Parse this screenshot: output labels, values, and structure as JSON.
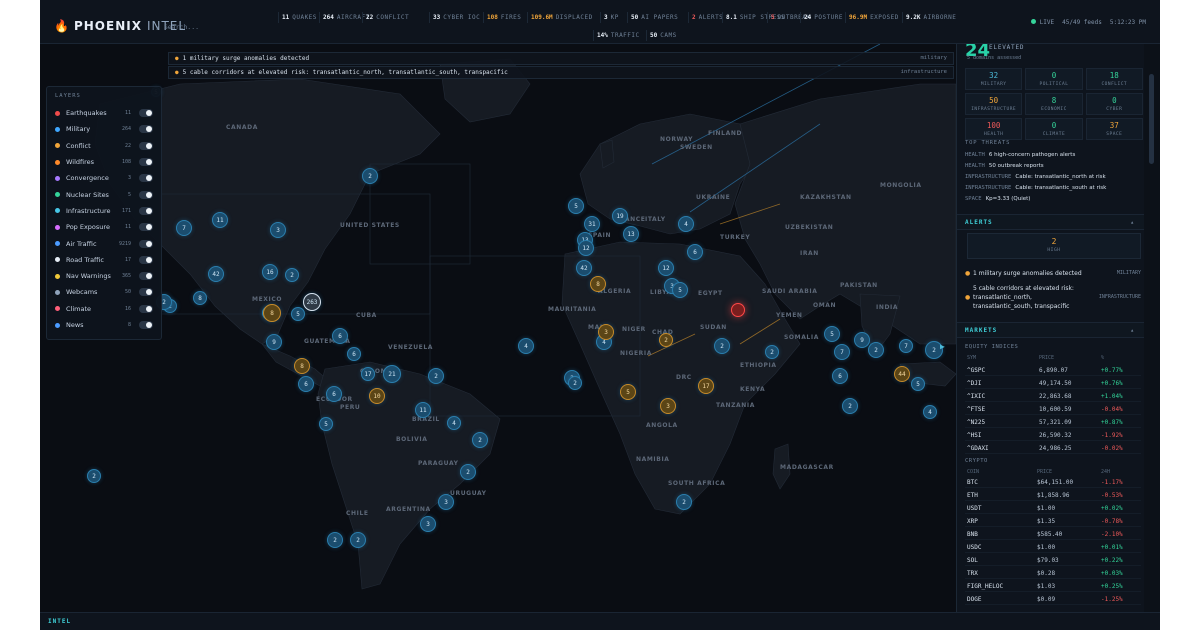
{
  "app": {
    "brand": "PHOENIX",
    "brand_suffix": "INTEL",
    "flame_icon": "flame-icon"
  },
  "search": {
    "placeholder": "/ Search..."
  },
  "stats": [
    {
      "num": "11",
      "label": "QUAKES",
      "tone": "normal"
    },
    {
      "num": "264",
      "label": "AIRCRAFT",
      "tone": "normal"
    },
    {
      "num": "22",
      "label": "CONFLICT",
      "tone": "normal"
    },
    {
      "num": "33",
      "label": "CYBER IOC",
      "tone": "normal"
    },
    {
      "num": "108",
      "label": "FIRES",
      "tone": "orange"
    },
    {
      "num": "109.6M",
      "label": "DISPLACED",
      "tone": "orange"
    },
    {
      "num": "3",
      "label": "KP",
      "tone": "normal"
    },
    {
      "num": "50",
      "label": "AI PAPERS",
      "tone": "normal"
    },
    {
      "num": "2",
      "label": "ALERTS",
      "tone": "red"
    },
    {
      "num": "8.1",
      "label": "SHIP STRESS",
      "tone": "normal"
    },
    {
      "num": "5",
      "label": "OUTBREAK",
      "tone": "red"
    },
    {
      "num": "24",
      "label": "POSTURE",
      "tone": "normal"
    },
    {
      "num": "96.9M",
      "label": "EXPOSED",
      "tone": "orange"
    },
    {
      "num": "9.2K",
      "label": "AIRBORNE",
      "tone": "normal"
    },
    {
      "num": "14%",
      "label": "TRAFFIC",
      "tone": "normal"
    },
    {
      "num": "50",
      "label": "CAMS",
      "tone": "normal"
    }
  ],
  "status": {
    "live": "LIVE",
    "feeds": "45/49 feeds",
    "time": "5:12:23 PM"
  },
  "ticker": [
    {
      "text": "1 military surge anomalies detected",
      "category": "military"
    },
    {
      "text": "5 cable corridors at elevated risk: transatlantic_north, transatlantic_south, transpacific",
      "category": "infrastructure"
    }
  ],
  "layers": {
    "header": "LAYERS",
    "items": [
      {
        "label": "Earthquakes",
        "count": "11",
        "color": "#ef4b4b"
      },
      {
        "label": "Military",
        "count": "264",
        "color": "#3fa7ff"
      },
      {
        "label": "Conflict",
        "count": "22",
        "color": "#f0a53a"
      },
      {
        "label": "Wildfires",
        "count": "108",
        "color": "#ff8a2a"
      },
      {
        "label": "Convergence",
        "count": "3",
        "color": "#a779ff"
      },
      {
        "label": "Nuclear Sites",
        "count": "5",
        "color": "#35d49a"
      },
      {
        "label": "Infrastructure",
        "count": "171",
        "color": "#47c6e6"
      },
      {
        "label": "Pop Exposure",
        "count": "11",
        "color": "#d66dff"
      },
      {
        "label": "Air Traffic",
        "count": "9219",
        "color": "#4b9bff"
      },
      {
        "label": "Road Traffic",
        "count": "17",
        "color": "#e6edf6"
      },
      {
        "label": "Nav Warnings",
        "count": "365",
        "color": "#f0c93a"
      },
      {
        "label": "Webcams",
        "count": "50",
        "color": "#8fa3bb"
      },
      {
        "label": "Climate",
        "count": "16",
        "color": "#ff5f7a"
      },
      {
        "label": "News",
        "count": "8",
        "color": "#4b9bff"
      }
    ]
  },
  "countries": [
    {
      "name": "CANADA"
    },
    {
      "name": "UNITED STATES"
    },
    {
      "name": "MEXICO"
    },
    {
      "name": "CUBA"
    },
    {
      "name": "GUATEMALA"
    },
    {
      "name": "VENEZUELA"
    },
    {
      "name": "COLOMBIA"
    },
    {
      "name": "ECUADOR"
    },
    {
      "name": "PERU"
    },
    {
      "name": "BRAZIL"
    },
    {
      "name": "BOLIVIA"
    },
    {
      "name": "PARAGUAY"
    },
    {
      "name": "CHILE"
    },
    {
      "name": "ARGENTINA"
    },
    {
      "name": "URUGUAY"
    },
    {
      "name": "ALGERIA"
    },
    {
      "name": "LIBYA"
    },
    {
      "name": "EGYPT"
    },
    {
      "name": "MALI"
    },
    {
      "name": "NIGER"
    },
    {
      "name": "CHAD"
    },
    {
      "name": "SUDAN"
    },
    {
      "name": "NIGERIA"
    },
    {
      "name": "ETHIOPIA"
    },
    {
      "name": "KENYA"
    },
    {
      "name": "ANGOLA"
    },
    {
      "name": "TANZANIA"
    },
    {
      "name": "NAMIBIA"
    },
    {
      "name": "SOUTH AFRICA"
    },
    {
      "name": "MADAGASCAR"
    },
    {
      "name": "MAURITANIA"
    },
    {
      "name": "TURKEY"
    },
    {
      "name": "IRAN"
    },
    {
      "name": "PAKISTAN"
    },
    {
      "name": "SAUDI ARABIA"
    },
    {
      "name": "KAZAKHSTAN"
    },
    {
      "name": "UZBEKISTAN"
    },
    {
      "name": "INDIA"
    },
    {
      "name": "MONGOLIA"
    },
    {
      "name": "UKRAINE"
    },
    {
      "name": "FRANCE"
    },
    {
      "name": "SPAIN"
    },
    {
      "name": "ITALY"
    },
    {
      "name": "YEMEN"
    },
    {
      "name": "OMAN"
    },
    {
      "name": "NORWAY"
    },
    {
      "name": "SWEDEN"
    },
    {
      "name": "FINLAND"
    },
    {
      "name": "SOMALIA"
    },
    {
      "name": "DRC"
    }
  ],
  "clusters": [
    {
      "v": "5",
      "t": "blue"
    },
    {
      "v": "2",
      "t": "blue"
    },
    {
      "v": "7",
      "t": "blue"
    },
    {
      "v": "11",
      "t": "blue"
    },
    {
      "v": "3",
      "t": "blue"
    },
    {
      "v": "42",
      "t": "blue"
    },
    {
      "v": "16",
      "t": "blue"
    },
    {
      "v": "8",
      "t": "blue"
    },
    {
      "v": "2",
      "t": "blue"
    },
    {
      "v": "17",
      "t": "blue"
    },
    {
      "v": "5",
      "t": "blue"
    },
    {
      "v": "263",
      "t": "white"
    },
    {
      "v": "8",
      "t": "amber"
    },
    {
      "v": "9",
      "t": "blue"
    },
    {
      "v": "6",
      "t": "blue"
    },
    {
      "v": "6",
      "t": "blue"
    },
    {
      "v": "8",
      "t": "amber"
    },
    {
      "v": "6",
      "t": "blue"
    },
    {
      "v": "17",
      "t": "blue"
    },
    {
      "v": "21",
      "t": "blue"
    },
    {
      "v": "2",
      "t": "blue"
    },
    {
      "v": "6",
      "t": "blue"
    },
    {
      "v": "10",
      "t": "amber"
    },
    {
      "v": "11",
      "t": "blue"
    },
    {
      "v": "5",
      "t": "blue"
    },
    {
      "v": "4",
      "t": "blue"
    },
    {
      "v": "2",
      "t": "blue"
    },
    {
      "v": "2",
      "t": "blue"
    },
    {
      "v": "3",
      "t": "blue"
    },
    {
      "v": "3",
      "t": "blue"
    },
    {
      "v": "2",
      "t": "blue"
    },
    {
      "v": "2",
      "t": "blue"
    },
    {
      "v": "3",
      "t": "blue"
    },
    {
      "v": "2",
      "t": "blue"
    },
    {
      "v": "2",
      "t": "blue"
    },
    {
      "v": "2",
      "t": "blue"
    },
    {
      "v": "4",
      "t": "blue"
    },
    {
      "v": "4",
      "t": "blue"
    },
    {
      "v": "5",
      "t": "blue"
    },
    {
      "v": "19",
      "t": "blue"
    },
    {
      "v": "13",
      "t": "blue"
    },
    {
      "v": "31",
      "t": "blue"
    },
    {
      "v": "4",
      "t": "blue"
    },
    {
      "v": "12",
      "t": "blue"
    },
    {
      "v": "42",
      "t": "blue"
    },
    {
      "v": "13",
      "t": "blue"
    },
    {
      "v": "6",
      "t": "blue"
    },
    {
      "v": "12",
      "t": "blue"
    },
    {
      "v": "3",
      "t": "blue"
    },
    {
      "v": "8",
      "t": "amber"
    },
    {
      "v": "5",
      "t": "blue"
    },
    {
      "v": "3",
      "t": "amber"
    },
    {
      "v": "2",
      "t": "amber"
    },
    {
      "v": "2",
      "t": "blue"
    },
    {
      "v": "2",
      "t": "blue"
    },
    {
      "v": "5",
      "t": "amber"
    },
    {
      "v": "3",
      "t": "amber"
    },
    {
      "v": "17",
      "t": "amber"
    },
    {
      "v": "2",
      "t": "blue"
    },
    {
      "v": "2",
      "t": "blue"
    },
    {
      "v": "5",
      "t": "blue"
    },
    {
      "v": "9",
      "t": "blue"
    },
    {
      "v": "2",
      "t": "blue"
    },
    {
      "v": "7",
      "t": "blue"
    },
    {
      "v": "44",
      "t": "amber"
    },
    {
      "v": "2",
      "t": "blue"
    },
    {
      "v": "7",
      "t": "blue"
    },
    {
      "v": "6",
      "t": "blue"
    },
    {
      "v": "5",
      "t": "blue"
    },
    {
      "v": "2",
      "t": "blue"
    },
    {
      "v": "4",
      "t": "blue"
    },
    {
      "v": "2",
      "t": "blue"
    },
    {
      "v": "",
      "t": "red"
    },
    {
      "v": "",
      "t": "red"
    }
  ],
  "posture": {
    "value": "24",
    "label": "ELEVATED",
    "assessed": "5 domains assessed",
    "metrics": [
      {
        "v": "32",
        "k": "MILITARY",
        "c": "#4bbad8"
      },
      {
        "v": "0",
        "k": "POLITICAL",
        "c": "#35d49a"
      },
      {
        "v": "18",
        "k": "CONFLICT",
        "c": "#35d49a"
      },
      {
        "v": "50",
        "k": "INFRASTRUCTURE",
        "c": "#f0a53a"
      },
      {
        "v": "8",
        "k": "ECONOMIC",
        "c": "#35d49a"
      },
      {
        "v": "0",
        "k": "CYBER",
        "c": "#35d49a"
      },
      {
        "v": "100",
        "k": "HEALTH",
        "c": "#ef5a5a"
      },
      {
        "v": "0",
        "k": "CLIMATE",
        "c": "#35d49a"
      },
      {
        "v": "37",
        "k": "SPACE",
        "c": "#f0a53a"
      }
    ]
  },
  "threats": {
    "header": "TOP THREATS",
    "items": [
      {
        "k": "HEALTH",
        "t": "6 high-concern pathogen alerts"
      },
      {
        "k": "HEALTH",
        "t": "50 outbreak reports"
      },
      {
        "k": "INFRASTRUCTURE",
        "t": "Cable: transatlantic_north at risk"
      },
      {
        "k": "INFRASTRUCTURE",
        "t": "Cable: transatlantic_south at risk"
      },
      {
        "k": "SPACE",
        "t": "Kp=3.33 (Quiet)"
      }
    ]
  },
  "alerts": {
    "title": "ALERTS",
    "count": "2",
    "count_label": "HIGH",
    "items": [
      {
        "text": "1 military surge anomalies detected",
        "category": "MILITARY"
      },
      {
        "text": "5 cable corridors at elevated risk: transatlantic_north, transatlantic_south, transpacific",
        "category": "INFRASTRUCTURE"
      }
    ]
  },
  "markets": {
    "title": "MARKETS",
    "equity_label": "EQUITY INDICES",
    "equity_cols": [
      "SYM",
      "PRICE",
      "%"
    ],
    "equity": [
      {
        "sym": "^GSPC",
        "price": "6,890.07",
        "chg": "+0.77%",
        "dir": "up"
      },
      {
        "sym": "^DJI",
        "price": "49,174.50",
        "chg": "+0.76%",
        "dir": "up"
      },
      {
        "sym": "^IXIC",
        "price": "22,863.68",
        "chg": "+1.04%",
        "dir": "up"
      },
      {
        "sym": "^FTSE",
        "price": "10,600.59",
        "chg": "-0.04%",
        "dir": "dn"
      },
      {
        "sym": "^N225",
        "price": "57,321.09",
        "chg": "+0.87%",
        "dir": "up"
      },
      {
        "sym": "^HSI",
        "price": "26,590.32",
        "chg": "-1.92%",
        "dir": "dn"
      },
      {
        "sym": "^GDAXI",
        "price": "24,986.25",
        "chg": "-0.02%",
        "dir": "dn"
      }
    ],
    "crypto_label": "CRYPTO",
    "crypto_cols": [
      "COIN",
      "PRICE",
      "24H"
    ],
    "crypto": [
      {
        "sym": "BTC",
        "price": "$64,151.00",
        "chg": "-1.17%",
        "dir": "dn"
      },
      {
        "sym": "ETH",
        "price": "$1,858.96",
        "chg": "-0.53%",
        "dir": "dn"
      },
      {
        "sym": "USDT",
        "price": "$1.00",
        "chg": "+0.02%",
        "dir": "up"
      },
      {
        "sym": "XRP",
        "price": "$1.35",
        "chg": "-0.78%",
        "dir": "dn"
      },
      {
        "sym": "BNB",
        "price": "$585.40",
        "chg": "-2.10%",
        "dir": "dn"
      },
      {
        "sym": "USDC",
        "price": "$1.00",
        "chg": "+0.01%",
        "dir": "up"
      },
      {
        "sym": "SOL",
        "price": "$79.03",
        "chg": "+0.22%",
        "dir": "up"
      },
      {
        "sym": "TRX",
        "price": "$0.28",
        "chg": "+0.03%",
        "dir": "up"
      },
      {
        "sym": "FIGR_HELOC",
        "price": "$1.03",
        "chg": "+0.25%",
        "dir": "up"
      },
      {
        "sym": "DOGE",
        "price": "$0.09",
        "chg": "-1.25%",
        "dir": "dn"
      }
    ]
  },
  "bottom": {
    "label": "INTEL"
  },
  "zoom": {
    "in": "+",
    "out": "−"
  }
}
